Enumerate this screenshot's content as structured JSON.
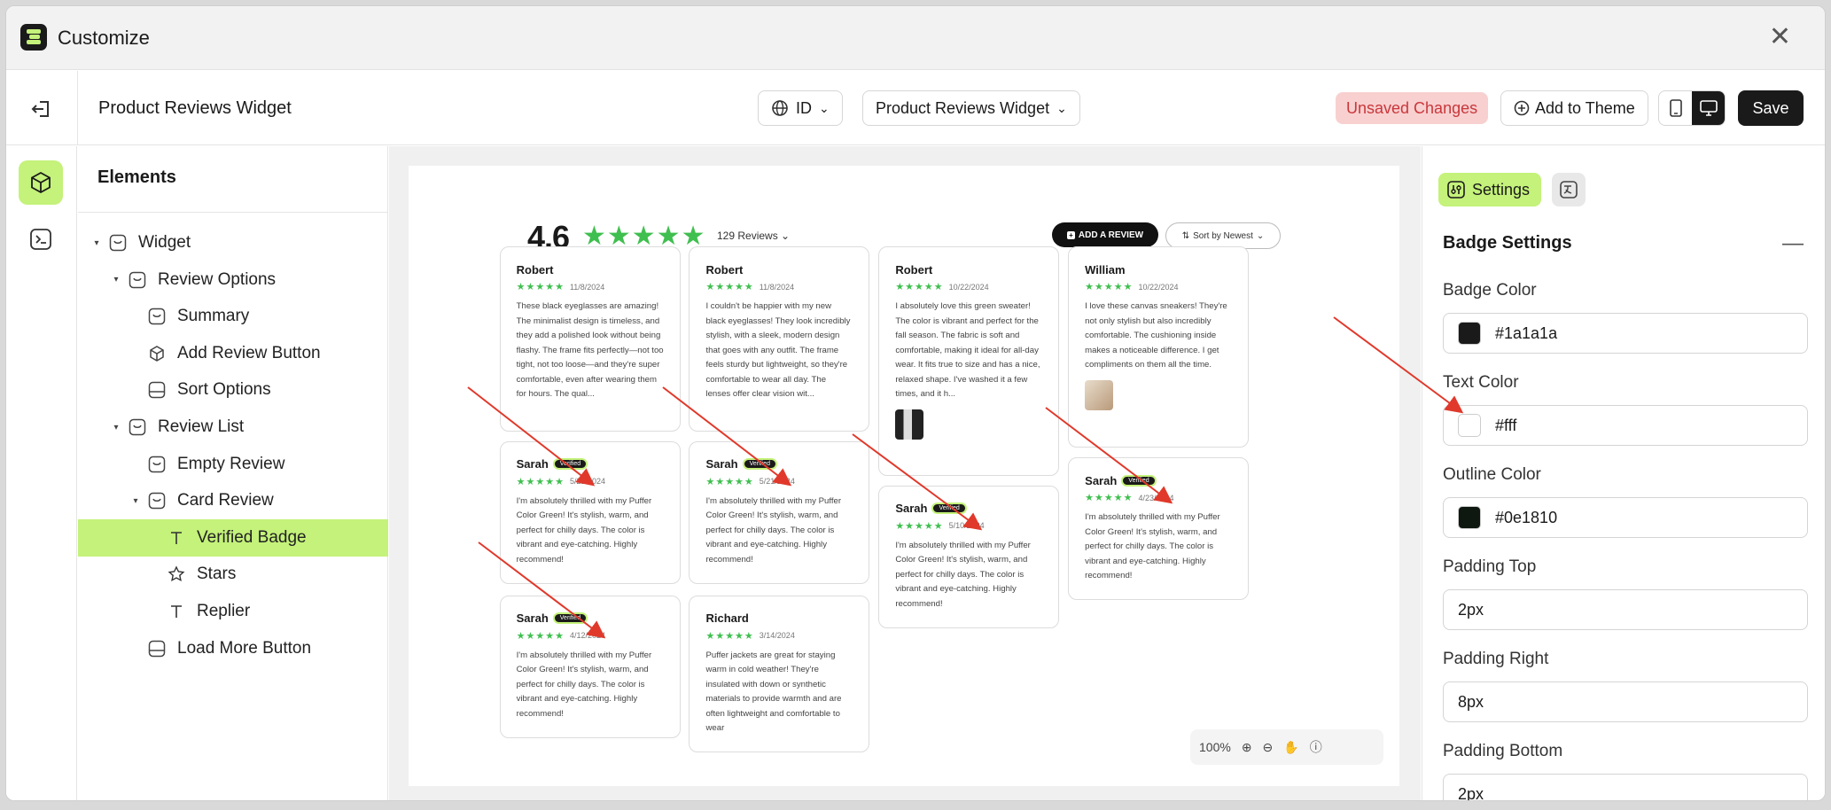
{
  "window": {
    "title": "Customize"
  },
  "topbar": {
    "page_name": "Product Reviews Widget",
    "language": "ID",
    "widget_select": "Product Reviews Widget",
    "unsaved": "Unsaved Changes",
    "add_to_theme": "Add to Theme",
    "save": "Save"
  },
  "tree": {
    "title": "Elements",
    "nodes": [
      {
        "label": "Widget"
      },
      {
        "label": "Review Options"
      },
      {
        "label": "Summary"
      },
      {
        "label": "Add Review Button"
      },
      {
        "label": "Sort Options"
      },
      {
        "label": "Review List"
      },
      {
        "label": "Empty Review"
      },
      {
        "label": "Card Review"
      },
      {
        "label": "Verified Badge"
      },
      {
        "label": "Stars"
      },
      {
        "label": "Replier"
      },
      {
        "label": "Load More Button"
      }
    ]
  },
  "preview": {
    "rating": "4.6",
    "stars": "★★★★★",
    "review_count": "129 Reviews",
    "add_review": "ADD A REVIEW",
    "sort": "Sort by Newest",
    "verified": "Verified",
    "card_stars": "★★★★★",
    "cards": [
      {
        "name": "Robert",
        "date": "11/8/2024",
        "text": "These black eyeglasses are amazing! The minimalist design is timeless, and they add a polished look without being flashy. The frame fits perfectly—not too tight, not too loose—and they're super comfortable, even after wearing them for hours. The qual..."
      },
      {
        "name": "Robert",
        "date": "11/8/2024",
        "text": "I couldn't be happier with my new black eyeglasses! They look incredibly stylish, with a sleek, modern design that goes with any outfit. The frame feels sturdy but lightweight, so they're comfortable to wear all day. The lenses offer clear vision wit..."
      },
      {
        "name": "Robert",
        "date": "10/22/2024",
        "text": "I absolutely love this green sweater! The color is vibrant and perfect for the fall season. The fabric is soft and comfortable, making it ideal for all-day wear. It fits true to size and has a nice, relaxed shape. I've washed it a few times, and it h..."
      },
      {
        "name": "William",
        "date": "10/22/2024",
        "text": "I love these canvas sneakers! They're not only stylish but also incredibly comfortable. The cushioning inside makes a noticeable difference. I get compliments on them all the time."
      },
      {
        "name": "Sarah",
        "date": "5/21/2024",
        "text": "I'm absolutely thrilled with my Puffer Color Green! It's stylish, warm, and perfect for chilly days. The color is vibrant and eye-catching. Highly recommend!"
      },
      {
        "name": "Sarah",
        "date": "5/21/2024",
        "text": "I'm absolutely thrilled with my Puffer Color Green! It's stylish, warm, and perfect for chilly days. The color is vibrant and eye-catching. Highly recommend!"
      },
      {
        "name": "Sarah",
        "date": "5/10/2024",
        "text": "I'm absolutely thrilled with my Puffer Color Green! It's stylish, warm, and perfect for chilly days. The color is vibrant and eye-catching. Highly recommend!"
      },
      {
        "name": "Sarah",
        "date": "4/23/2024",
        "text": "I'm absolutely thrilled with my Puffer Color Green! It's stylish, warm, and perfect for chilly days. The color is vibrant and eye-catching. Highly recommend!"
      },
      {
        "name": "Sarah",
        "date": "4/12/2024",
        "text": "I'm absolutely thrilled with my Puffer Color Green! It's stylish, warm, and perfect for chilly days. The color is vibrant and eye-catching. Highly recommend!"
      },
      {
        "name": "Richard",
        "date": "3/14/2024",
        "text": "Puffer jackets are great for staying warm in cold weather! They're insulated with down or synthetic materials to provide warmth and are often lightweight and comfortable to wear"
      }
    ],
    "zoom": "100%"
  },
  "settings": {
    "tab": "Settings",
    "section": "Badge Settings",
    "badge_color_label": "Badge Color",
    "badge_color": "#1a1a1a",
    "text_color_label": "Text Color",
    "text_color": "#fff",
    "outline_color_label": "Outline Color",
    "outline_color": "#0e1810",
    "padding_top_label": "Padding Top",
    "padding_top": "2px",
    "padding_right_label": "Padding Right",
    "padding_right": "8px",
    "padding_bottom_label": "Padding Bottom",
    "padding_bottom": "2px"
  },
  "colors": {
    "accent": "#c4f27a",
    "star": "#3fbf4f",
    "annotation": "#e0392b"
  }
}
